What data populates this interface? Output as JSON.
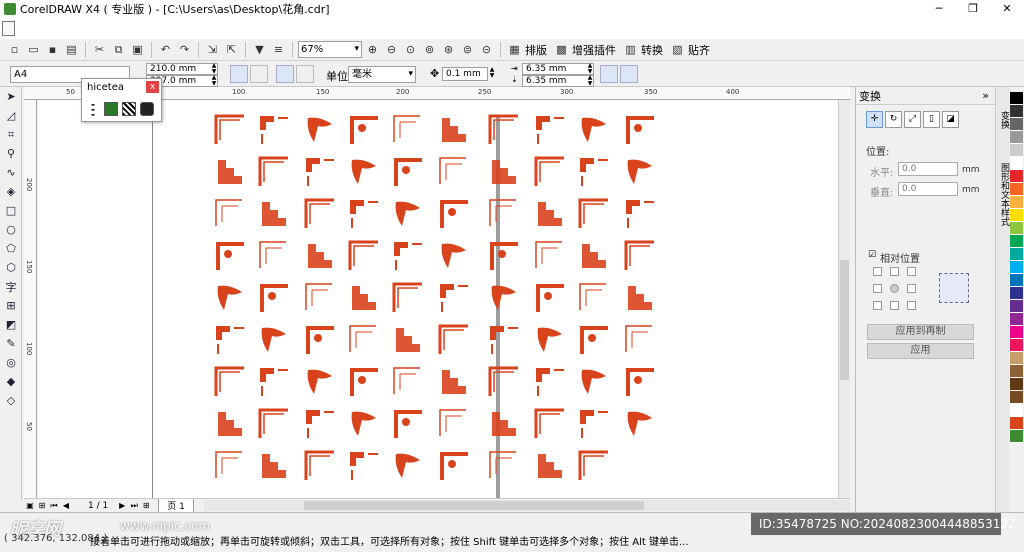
{
  "window": {
    "title": "CorelDRAW X4 ( 专业版 ) - [C:\\Users\\as\\Desktop\\花角.cdr]",
    "minimize": "─",
    "restore": "❐",
    "close": "✕"
  },
  "toolbar": {
    "zoom_value": "67%",
    "arrange_label": "排版",
    "enhance_plugin_label": "增强插件",
    "convert_label": "转换",
    "align_label": "贴齐"
  },
  "property_bar": {
    "page_size": "A4",
    "width": "210.0 mm",
    "height": "297.0 mm",
    "units_label": "单位:",
    "units_value": "毫米",
    "nudge": "0.1 mm",
    "dup_x": "6.35 mm",
    "dup_y": "6.35 mm"
  },
  "plugin": {
    "title": "hicetea",
    "close": "x"
  },
  "ruler": {
    "h_ticks": [
      "50",
      "50",
      "100",
      "150",
      "200",
      "250",
      "300",
      "350",
      "400"
    ],
    "v_ticks": [
      "200",
      "150",
      "100",
      "50"
    ]
  },
  "page_nav": {
    "current": "1 / 1",
    "page_tab": "页 1"
  },
  "docker": {
    "title": "变换",
    "position_label": "位置:",
    "h_label": "水平:",
    "h_value": "0.0",
    "v_label": "垂直:",
    "v_value": "0.0",
    "unit": "mm",
    "relative_label": "相对位置",
    "apply_copy": "应用到再制",
    "apply": "应用"
  },
  "side_tabs": {
    "tab1": "变换",
    "tab2": "图形和文本样式"
  },
  "status": {
    "coords": "( 342.376, 132.084 )",
    "hint": "接着单击可进行拖动或缩放；再单击可旋转或倾斜；双击工具，可选择所有对象；按住 Shift 键单击可选择多个对象；按住 Alt 键单击...",
    "watermark": "昵享网",
    "watermark_url": "www.nipic.com",
    "image_id": "ID:35478725 NO:20240823004448853122"
  },
  "colors": {
    "ornament": "#d9431c",
    "palette": [
      "#000000",
      "#333333",
      "#666666",
      "#999999",
      "#cccccc",
      "#ffffff",
      "#e8262a",
      "#f26522",
      "#fbb040",
      "#ffdd00",
      "#8dc63f",
      "#00a651",
      "#00a99d",
      "#00aeef",
      "#0072bc",
      "#2e3192",
      "#662d91",
      "#92278f",
      "#ec008c",
      "#ed145b",
      "#c69c6d",
      "#8c6239",
      "#603913",
      "#754c24",
      "#ffffff",
      "#d9431c",
      "#3a8c2f"
    ]
  }
}
